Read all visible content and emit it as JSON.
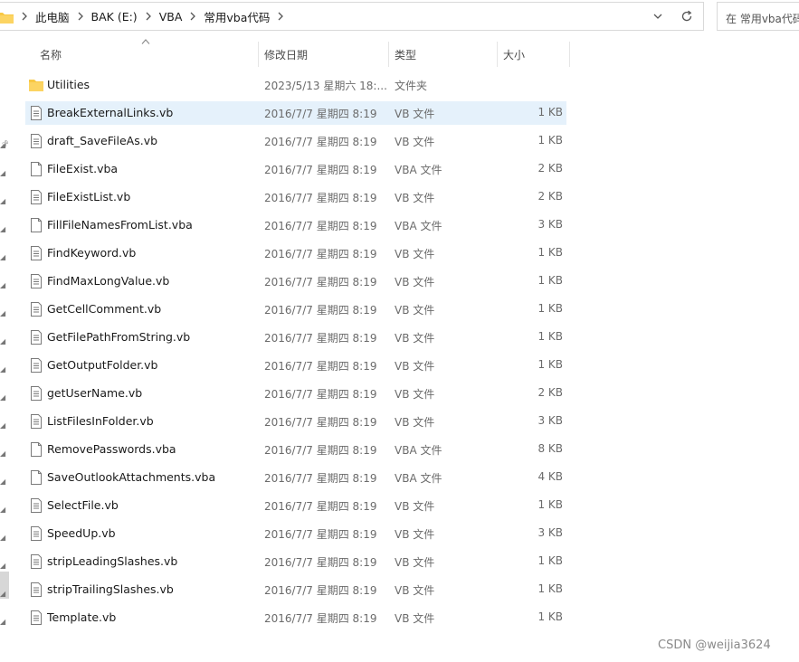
{
  "breadcrumb": [
    "此电脑",
    "BAK (E:)",
    "VBA",
    "常用vba代码"
  ],
  "search": {
    "placeholder": "在 常用vba代码 中搜索"
  },
  "columns": {
    "name": "名称",
    "modified": "修改日期",
    "type": "类型",
    "size": "大小"
  },
  "files": [
    {
      "name": "Utilities",
      "modified": "2023/5/13 星期六 18:...",
      "type": "文件夹",
      "size": "",
      "icon": "folder-icon",
      "selected": false
    },
    {
      "name": "BreakExternalLinks.vb",
      "modified": "2016/7/7 星期四 8:19",
      "type": "VB 文件",
      "size": "1 KB",
      "icon": "text-file-icon",
      "selected": true
    },
    {
      "name": "draft_SaveFileAs.vb",
      "modified": "2016/7/7 星期四 8:19",
      "type": "VB 文件",
      "size": "1 KB",
      "icon": "text-file-icon",
      "selected": false
    },
    {
      "name": "FileExist.vba",
      "modified": "2016/7/7 星期四 8:19",
      "type": "VBA 文件",
      "size": "2 KB",
      "icon": "blank-file-icon",
      "selected": false
    },
    {
      "name": "FileExistList.vb",
      "modified": "2016/7/7 星期四 8:19",
      "type": "VB 文件",
      "size": "2 KB",
      "icon": "text-file-icon",
      "selected": false
    },
    {
      "name": "FillFileNamesFromList.vba",
      "modified": "2016/7/7 星期四 8:19",
      "type": "VBA 文件",
      "size": "3 KB",
      "icon": "blank-file-icon",
      "selected": false
    },
    {
      "name": "FindKeyword.vb",
      "modified": "2016/7/7 星期四 8:19",
      "type": "VB 文件",
      "size": "1 KB",
      "icon": "text-file-icon",
      "selected": false
    },
    {
      "name": "FindMaxLongValue.vb",
      "modified": "2016/7/7 星期四 8:19",
      "type": "VB 文件",
      "size": "1 KB",
      "icon": "text-file-icon",
      "selected": false
    },
    {
      "name": "GetCellComment.vb",
      "modified": "2016/7/7 星期四 8:19",
      "type": "VB 文件",
      "size": "1 KB",
      "icon": "text-file-icon",
      "selected": false
    },
    {
      "name": "GetFilePathFromString.vb",
      "modified": "2016/7/7 星期四 8:19",
      "type": "VB 文件",
      "size": "1 KB",
      "icon": "text-file-icon",
      "selected": false
    },
    {
      "name": "GetOutputFolder.vb",
      "modified": "2016/7/7 星期四 8:19",
      "type": "VB 文件",
      "size": "1 KB",
      "icon": "text-file-icon",
      "selected": false
    },
    {
      "name": "getUserName.vb",
      "modified": "2016/7/7 星期四 8:19",
      "type": "VB 文件",
      "size": "2 KB",
      "icon": "text-file-icon",
      "selected": false
    },
    {
      "name": "ListFilesInFolder.vb",
      "modified": "2016/7/7 星期四 8:19",
      "type": "VB 文件",
      "size": "3 KB",
      "icon": "text-file-icon",
      "selected": false
    },
    {
      "name": "RemovePasswords.vba",
      "modified": "2016/7/7 星期四 8:19",
      "type": "VBA 文件",
      "size": "8 KB",
      "icon": "blank-file-icon",
      "selected": false
    },
    {
      "name": "SaveOutlookAttachments.vba",
      "modified": "2016/7/7 星期四 8:19",
      "type": "VBA 文件",
      "size": "4 KB",
      "icon": "blank-file-icon",
      "selected": false
    },
    {
      "name": "SelectFile.vb",
      "modified": "2016/7/7 星期四 8:19",
      "type": "VB 文件",
      "size": "1 KB",
      "icon": "text-file-icon",
      "selected": false
    },
    {
      "name": "SpeedUp.vb",
      "modified": "2016/7/7 星期四 8:19",
      "type": "VB 文件",
      "size": "3 KB",
      "icon": "text-file-icon",
      "selected": false
    },
    {
      "name": "stripLeadingSlashes.vb",
      "modified": "2016/7/7 星期四 8:19",
      "type": "VB 文件",
      "size": "1 KB",
      "icon": "text-file-icon",
      "selected": false
    },
    {
      "name": "stripTrailingSlashes.vb",
      "modified": "2016/7/7 星期四 8:19",
      "type": "VB 文件",
      "size": "1 KB",
      "icon": "text-file-icon",
      "selected": false
    },
    {
      "name": "Template.vb",
      "modified": "2016/7/7 星期四 8:19",
      "type": "VB 文件",
      "size": "1 KB",
      "icon": "text-file-icon",
      "selected": false
    }
  ],
  "watermark": "CSDN @weijia3624",
  "colors": {
    "folder": "#f8c843",
    "selection": "#e5f1fb",
    "border": "#d9d9d9"
  }
}
